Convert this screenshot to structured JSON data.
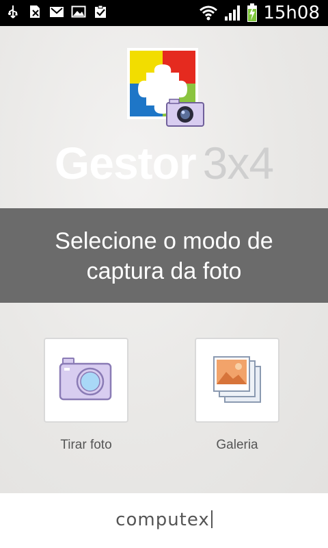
{
  "status_bar": {
    "time": "15h08",
    "icons": [
      "usb-icon",
      "sim-card-icon",
      "gmail-icon",
      "image-icon",
      "clipboard-check-icon",
      "wifi-icon",
      "signal-icon",
      "battery-charging-icon"
    ]
  },
  "app": {
    "title_primary": "Gestor",
    "title_secondary": "3x4",
    "logo_icon": "puzzle-camera-logo"
  },
  "banner": {
    "line1": "Selecione o modo de",
    "line2": "captura da foto"
  },
  "options": [
    {
      "label": "Tirar foto",
      "icon": "camera-icon"
    },
    {
      "label": "Galeria",
      "icon": "gallery-icon"
    }
  ],
  "footer": {
    "brand": "computex"
  },
  "colors": {
    "banner_bg": "#6b6b6b",
    "puzzle_yellow": "#f2dd00",
    "puzzle_red": "#e52a1f",
    "puzzle_blue": "#1e76c7",
    "puzzle_green": "#8bc43f",
    "camera_lavender": "#d8cdf0"
  }
}
